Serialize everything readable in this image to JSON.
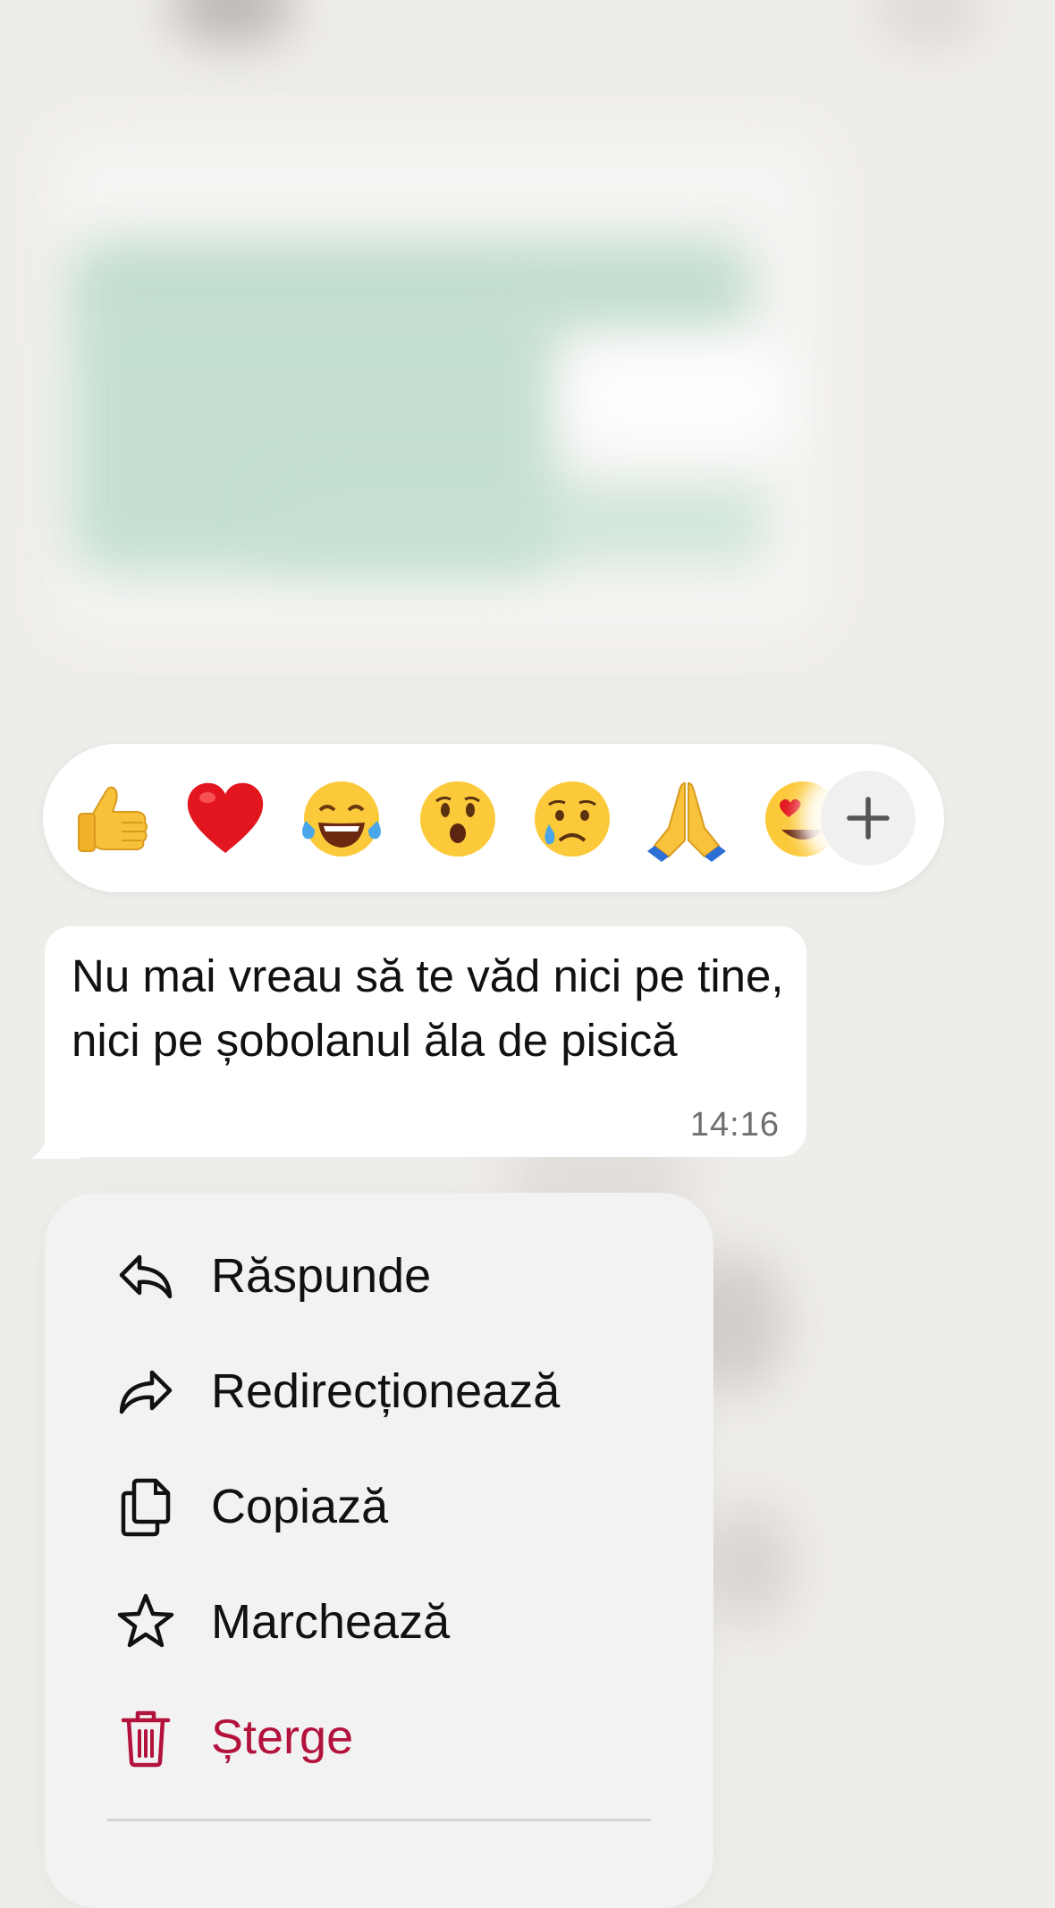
{
  "reactions": {
    "emojis": [
      {
        "name": "thumbs-up",
        "glyph": "👍"
      },
      {
        "name": "red-heart",
        "glyph": "❤️"
      },
      {
        "name": "tears-of-joy",
        "glyph": "😂"
      },
      {
        "name": "surprised",
        "glyph": "😮"
      },
      {
        "name": "crying",
        "glyph": "😢"
      },
      {
        "name": "folded-hands",
        "glyph": "🙏"
      },
      {
        "name": "heart-eyes",
        "glyph": "😍"
      }
    ],
    "more_icon": "plus-icon"
  },
  "message": {
    "text": "Nu mai vreau să te văd nici pe tine, nici pe șobolanul ăla de pisică",
    "time": "14:16"
  },
  "menu": {
    "items": [
      {
        "id": "reply",
        "label": "Răspunde",
        "icon": "reply-arrow-icon"
      },
      {
        "id": "forward",
        "label": "Redirecționează",
        "icon": "forward-arrow-icon"
      },
      {
        "id": "copy",
        "label": "Copiază",
        "icon": "copy-icon"
      },
      {
        "id": "star",
        "label": "Marchează",
        "icon": "star-icon"
      },
      {
        "id": "delete",
        "label": "Șterge",
        "icon": "trash-icon"
      }
    ]
  },
  "colors": {
    "background": "#efedea",
    "bubble": "#ffffff",
    "menu_background": "#f2f2f3",
    "danger": "#b3123d",
    "text": "#111111",
    "timestamp": "#6f6f6f"
  }
}
